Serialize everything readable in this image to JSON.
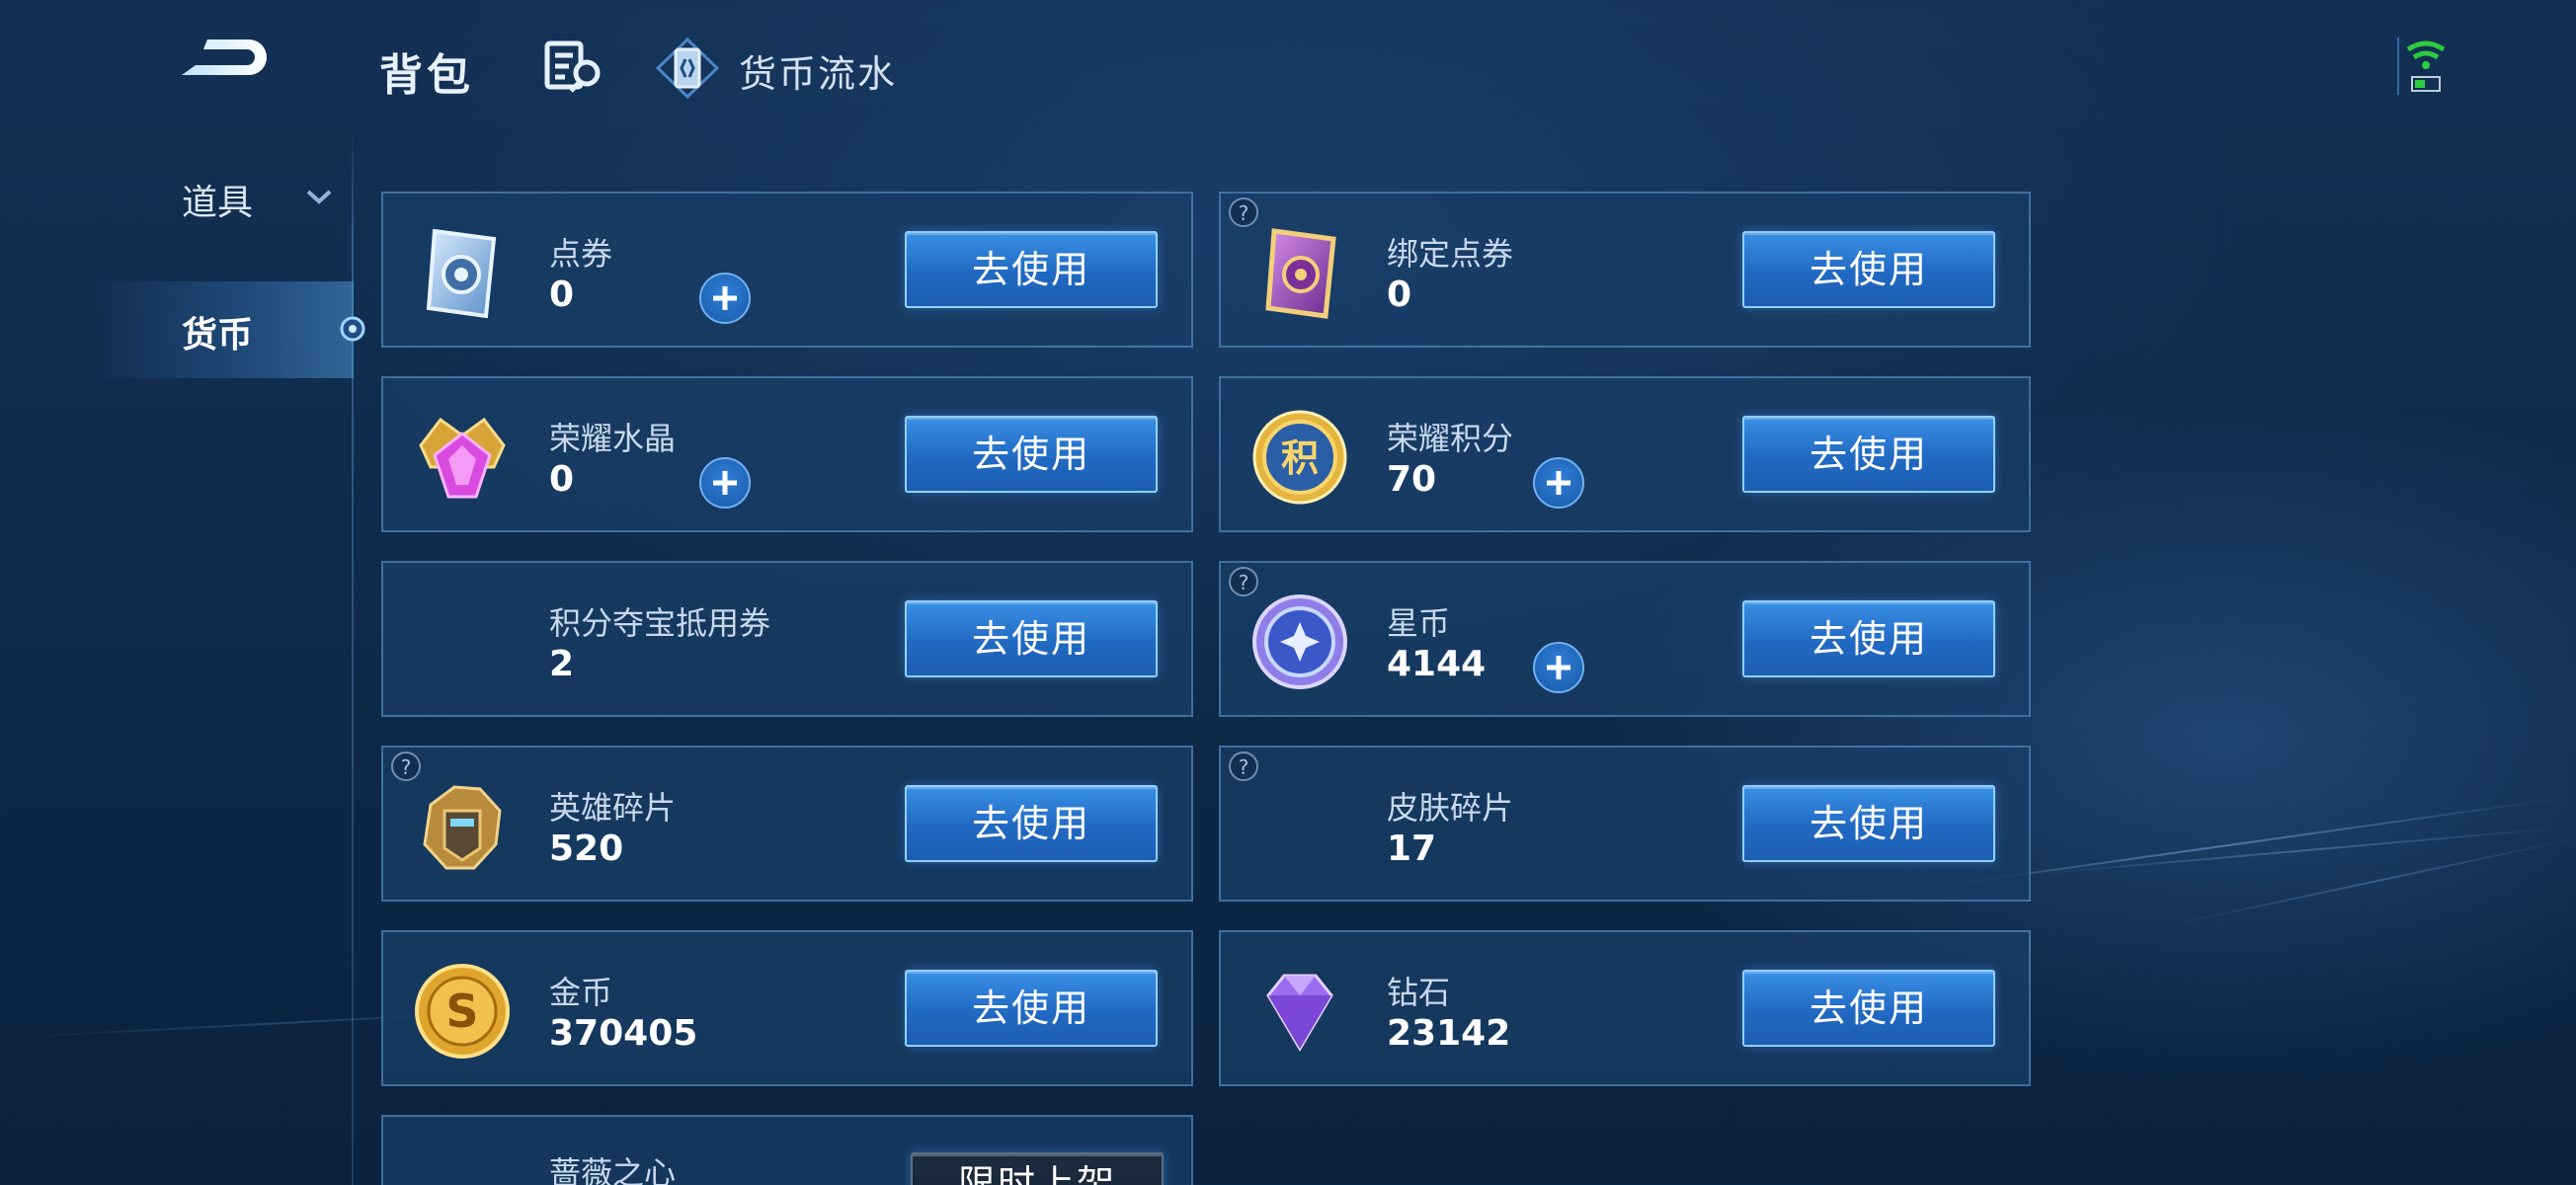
{
  "header": {
    "title": "背包",
    "flow_label": "货币流水"
  },
  "sidebar": {
    "items": [
      {
        "label": "道具",
        "active": false
      },
      {
        "label": "货币",
        "active": true
      }
    ]
  },
  "currencies": [
    {
      "name": "点券",
      "value": "0",
      "button": "去使用",
      "has_plus": true,
      "has_help": false,
      "icon": "coupon-ticket-icon"
    },
    {
      "name": "绑定点券",
      "value": "0",
      "button": "去使用",
      "has_plus": false,
      "has_help": true,
      "icon": "bound-coupon-ticket-icon"
    },
    {
      "name": "荣耀水晶",
      "value": "0",
      "button": "去使用",
      "has_plus": true,
      "has_help": false,
      "icon": "glory-crystal-icon"
    },
    {
      "name": "荣耀积分",
      "value": "70",
      "button": "去使用",
      "has_plus": true,
      "has_help": false,
      "icon": "glory-points-icon"
    },
    {
      "name": "积分夺宝抵用券",
      "value": "2",
      "button": "去使用",
      "has_plus": false,
      "has_help": false,
      "icon": ""
    },
    {
      "name": "星币",
      "value": "4144",
      "button": "去使用",
      "has_plus": true,
      "has_help": true,
      "icon": "star-coin-icon"
    },
    {
      "name": "英雄碎片",
      "value": "520",
      "button": "去使用",
      "has_plus": false,
      "has_help": true,
      "icon": "hero-fragment-icon"
    },
    {
      "name": "皮肤碎片",
      "value": "17",
      "button": "去使用",
      "has_plus": false,
      "has_help": true,
      "icon": ""
    },
    {
      "name": "金币",
      "value": "370405",
      "button": "去使用",
      "has_plus": false,
      "has_help": false,
      "icon": "gold-coin-icon"
    },
    {
      "name": "钻石",
      "value": "23142",
      "button": "去使用",
      "has_plus": false,
      "has_help": false,
      "icon": "diamond-icon"
    },
    {
      "name": "蔷薇之心",
      "value": "",
      "button": "限时上架",
      "has_plus": false,
      "has_help": false,
      "icon": ""
    }
  ],
  "colors": {
    "accent": "#2a7ad6",
    "background": "#133155",
    "card": "#183e66",
    "card_border": "#629ed4",
    "wifi": "#2ecc40"
  }
}
